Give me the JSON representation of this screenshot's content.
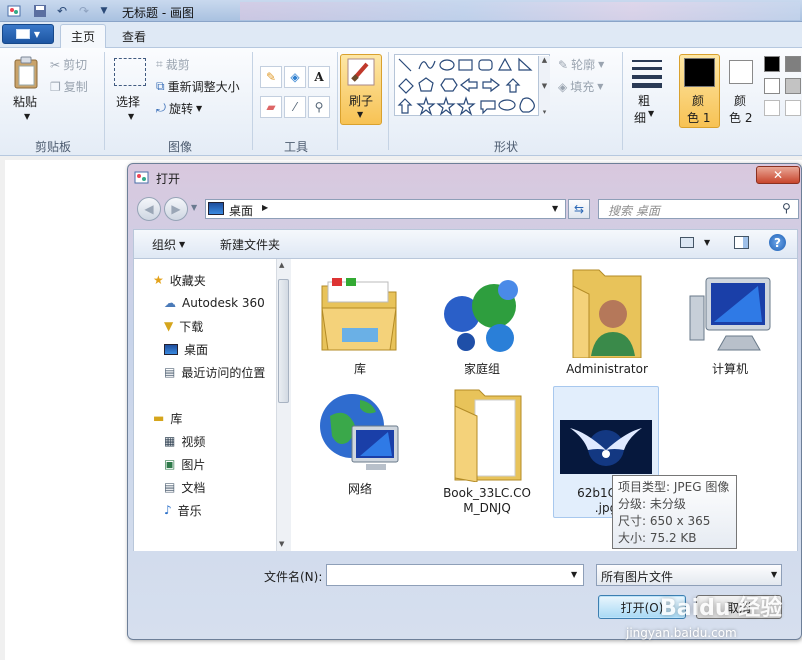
{
  "window": {
    "title": "无标题 - 画图"
  },
  "ribbon": {
    "tabs": [
      "主页",
      "查看"
    ],
    "clipboard": {
      "paste": "粘贴",
      "cut": "剪切",
      "copy": "复制",
      "label": "剪贴板"
    },
    "image": {
      "select": "选择",
      "crop": "裁剪",
      "resize": "重新调整大小",
      "rotate": "旋转",
      "label": "图像"
    },
    "tools": {
      "label": "工具"
    },
    "brushes": {
      "label": "刷子"
    },
    "shapes": {
      "outline": "轮廓",
      "fill": "填充",
      "label": "形状"
    },
    "size": {
      "label_line1": "粗",
      "label_line2": "细"
    },
    "color1": {
      "line1": "颜",
      "line2": "色 1"
    },
    "color2": {
      "line1": "颜",
      "line2": "色 2"
    },
    "colors": {
      "color1": "#000000",
      "color2": "#ffffff",
      "accent": "#f7c254"
    }
  },
  "dialog": {
    "title": "打开",
    "address": "桌面",
    "search_placeholder": "搜索 桌面",
    "organize": "组织",
    "new_folder": "新建文件夹",
    "nav": {
      "favorites": "收藏夹",
      "fav_items": [
        "Autodesk 360",
        "下载",
        "桌面",
        "最近访问的位置"
      ],
      "libraries": "库",
      "lib_items": [
        "视频",
        "图片",
        "文档",
        "音乐"
      ]
    },
    "files": [
      "库",
      "家庭组",
      "Administrator",
      "计算机",
      "网络",
      "Book_33LC.CO\nM_DNJQ",
      "62b1OOC\n.jpg"
    ],
    "tooltip": {
      "type": "项目类型: JPEG 图像",
      "rating": "分级: 未分级",
      "dimensions": "尺寸: 650 x 365",
      "size": "大小: 75.2 KB"
    },
    "filename_label": "文件名(N):",
    "filename_value": "",
    "filetype": "所有图片文件",
    "open_button": "打开(O)",
    "cancel_button": "取消"
  },
  "watermark": {
    "brand": "Baidu 经验",
    "url": "jingyan.baidu.com"
  }
}
